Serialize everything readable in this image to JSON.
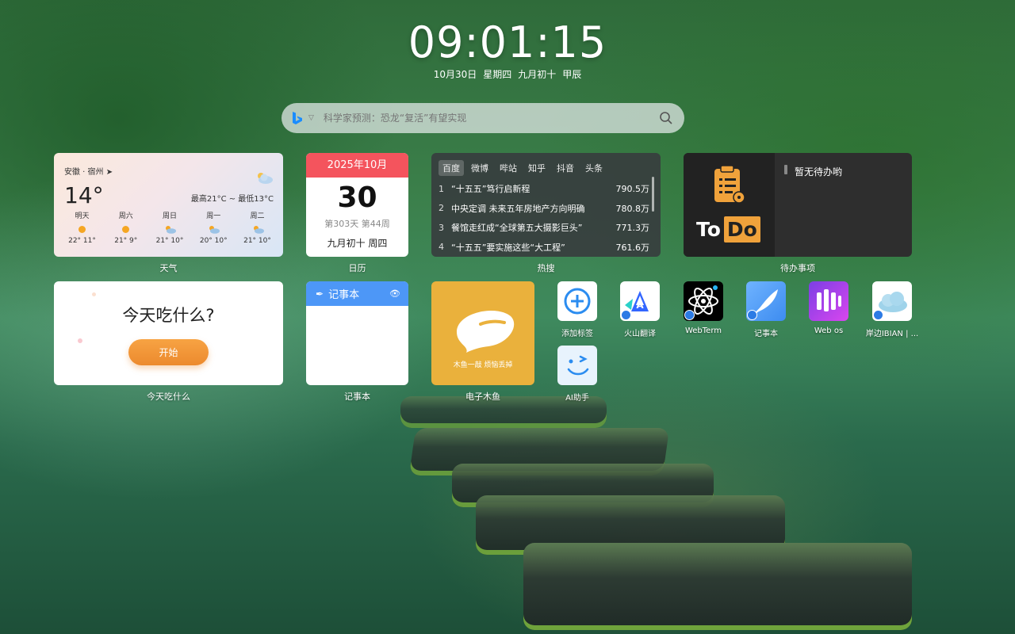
{
  "clock": {
    "time": "09:01:15",
    "date": "10月30日",
    "weekday": "星期四",
    "lunar": "九月初十",
    "ganzhi": "甲辰"
  },
  "search": {
    "placeholder": "科学家预测：恐龙“复活”有望实现"
  },
  "weather": {
    "location": "安徽 · 宿州",
    "temp": "14°",
    "range": "最高21°C ~ 最低13°C",
    "label": "天气",
    "forecast": [
      {
        "day": "明天",
        "temp": "22° 11°",
        "icon": "sun-icon"
      },
      {
        "day": "周六",
        "temp": "21° 9°",
        "icon": "sun-icon"
      },
      {
        "day": "周日",
        "temp": "21° 10°",
        "icon": "partly-cloudy-icon"
      },
      {
        "day": "周一",
        "temp": "20° 10°",
        "icon": "partly-cloudy-icon"
      },
      {
        "day": "周二",
        "temp": "21° 10°",
        "icon": "partly-cloudy-icon"
      }
    ]
  },
  "calendar": {
    "month": "2025年10月",
    "day": "30",
    "sub": "第303天 第44周",
    "lunar": "九月初十 周四",
    "label": "日历"
  },
  "hot": {
    "label": "热搜",
    "tabs": [
      "百度",
      "微博",
      "哔站",
      "知乎",
      "抖音",
      "头条"
    ],
    "rows": [
      {
        "rank": "1",
        "title": "“十五五”笃行启新程",
        "heat": "790.5万"
      },
      {
        "rank": "2",
        "title": "中央定调 未来五年房地产方向明确",
        "heat": "780.8万"
      },
      {
        "rank": "3",
        "title": "餐馆走红成“全球第五大摄影巨头”",
        "heat": "771.3万"
      },
      {
        "rank": "4",
        "title": "“十五五”要实施这些“大工程”",
        "heat": "761.6万"
      }
    ]
  },
  "todo": {
    "empty": "暂无待办哟",
    "label": "待办事项",
    "logo_to": "To",
    "logo_do": "Do"
  },
  "eat": {
    "question": "今天吃什么?",
    "button": "开始",
    "label": "今天吃什么"
  },
  "notes": {
    "title": "记事本",
    "label": "记事本"
  },
  "muyu": {
    "caption": "木鱼一敲 烦恼丢掉",
    "label": "电子木鱼"
  },
  "apps": [
    {
      "name": "添加标签"
    },
    {
      "name": "火山翻译"
    },
    {
      "name": "WebTerm"
    },
    {
      "name": "记事本"
    },
    {
      "name": "Web os"
    },
    {
      "name": "岸边IBIAN | ..."
    },
    {
      "name": "AI助手"
    }
  ]
}
